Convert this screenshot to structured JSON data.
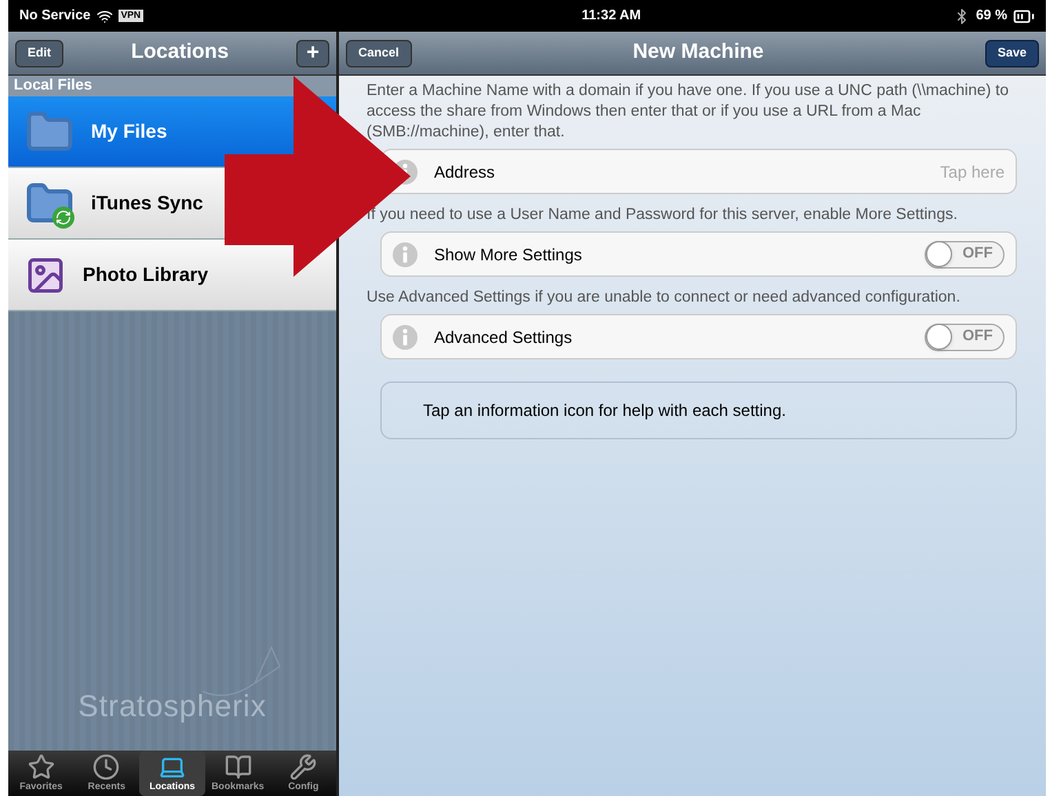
{
  "status_bar": {
    "carrier": "No Service",
    "vpn": "VPN",
    "time": "11:32 AM",
    "battery": "69 %"
  },
  "sidebar": {
    "edit_button": "Edit",
    "title": "Locations",
    "add_button": "+",
    "section": "Local Files",
    "items": [
      {
        "label": "My Files",
        "kind": "folder",
        "selected": true
      },
      {
        "label": "iTunes Sync",
        "kind": "sync",
        "selected": false
      },
      {
        "label": "Photo Library",
        "kind": "photos",
        "selected": false
      }
    ],
    "logo": "Stratospherix"
  },
  "tab_bar": [
    {
      "label": "Favorites",
      "kind": "star",
      "selected": false
    },
    {
      "label": "Recents",
      "kind": "clock",
      "selected": false
    },
    {
      "label": "Locations",
      "kind": "laptop",
      "selected": true
    },
    {
      "label": "Bookmarks",
      "kind": "book",
      "selected": false
    },
    {
      "label": "Config",
      "kind": "wrench",
      "selected": false
    }
  ],
  "detail": {
    "cancel_button": "Cancel",
    "title": "New Machine",
    "save_button": "Save",
    "sections": [
      {
        "help": "Enter a Machine Name with a domain if you have one.  If you use a UNC path (\\\\machine) to access the share from Windows then enter that or if you use a URL from a Mac (SMB://machine), enter that.",
        "kind": "field",
        "label": "Address",
        "placeholder": "Tap here"
      },
      {
        "help": "If you need to use a User Name and Password for this server, enable More Settings.",
        "kind": "toggle",
        "label": "Show More Settings",
        "on": false,
        "state_label": "OFF"
      },
      {
        "help": "Use Advanced Settings if you are unable to connect or need advanced configuration.",
        "kind": "toggle",
        "label": "Advanced Settings",
        "on": false,
        "state_label": "OFF"
      }
    ],
    "note": "Tap an information icon for help with each setting."
  }
}
